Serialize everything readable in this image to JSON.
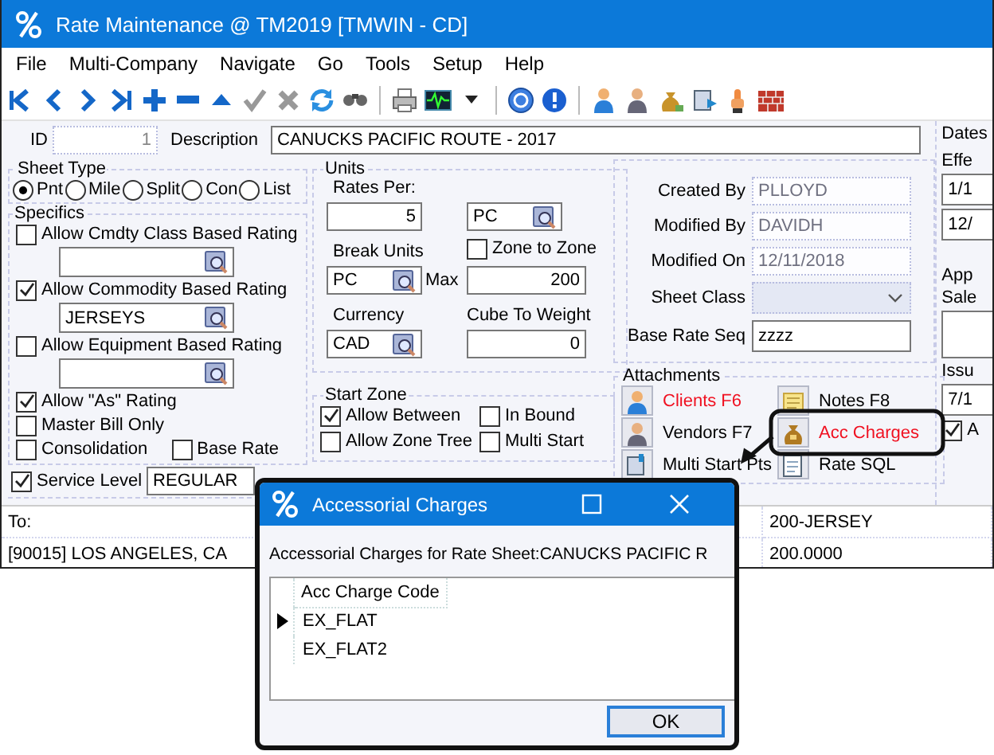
{
  "window": {
    "title": "Rate Maintenance @ TM2019 [TMWIN - CD]"
  },
  "menu": [
    "File",
    "Multi-Company",
    "Navigate",
    "Go",
    "Tools",
    "Setup",
    "Help"
  ],
  "header": {
    "id_label": "ID",
    "id": "1",
    "description_label": "Description",
    "description": "CANUCKS PACIFIC ROUTE - 2017"
  },
  "sheet_type": {
    "title": "Sheet Type",
    "options": [
      {
        "label": "Pnt",
        "selected": true
      },
      {
        "label": "Mile",
        "selected": false
      },
      {
        "label": "Split",
        "selected": false
      },
      {
        "label": "Con",
        "selected": false
      },
      {
        "label": "List",
        "selected": false
      }
    ]
  },
  "specifics": {
    "title": "Specifics",
    "items": [
      {
        "kind": "lookup",
        "label": "Allow Cmdty Class Based Rating",
        "checked": false
      },
      {
        "kind": "lookup",
        "label": "Allow Commodity Based Rating",
        "checked": true,
        "value": "JERSEYS"
      },
      {
        "kind": "lookup",
        "label": "Allow Equipment Based Rating",
        "checked": false
      },
      {
        "kind": "check",
        "label": "Allow \"As\" Rating",
        "checked": true
      },
      {
        "kind": "check",
        "label": "Master Bill Only",
        "checked": false
      },
      {
        "kind": "pair",
        "checks": [
          {
            "label": "Consolidation",
            "checked": false
          },
          {
            "label": "Base Rate",
            "checked": false
          }
        ]
      }
    ]
  },
  "service_level": {
    "label": "Service Level",
    "checked": true,
    "value": "REGULAR"
  },
  "units": {
    "title": "Units",
    "rates_per_label": "Rates Per:",
    "rates_per": "5",
    "rates_unit": "PC",
    "break_units_label": "Break Units",
    "break_units": "PC",
    "zone_to_zone": {
      "label": "Zone to Zone",
      "checked": false
    },
    "max_label": "Max",
    "max": "200",
    "currency_label": "Currency",
    "currency": "CAD",
    "cube_label": "Cube To Weight",
    "cube": "0"
  },
  "start_zone": {
    "title": "Start Zone",
    "checks": [
      {
        "label": "Allow Between",
        "checked": true
      },
      {
        "label": "In Bound",
        "checked": false
      },
      {
        "label": "Allow Zone Tree",
        "checked": false
      },
      {
        "label": "Multi Start",
        "checked": false
      }
    ]
  },
  "info": {
    "fields": [
      {
        "kind": "readonly",
        "label": "Created By",
        "value": "PLLOYD"
      },
      {
        "kind": "readonly",
        "label": "Modified By",
        "value": "DAVIDH"
      },
      {
        "kind": "readonly",
        "label": "Modified On",
        "value": "12/11/2018"
      },
      {
        "kind": "dropdown",
        "label": "Sheet Class"
      },
      {
        "kind": "text",
        "label": "Base Rate Seq",
        "value": "zzzz"
      }
    ]
  },
  "attachments": {
    "title": "Attachments",
    "items": [
      {
        "label": "Clients F6",
        "highlighted": true
      },
      {
        "label": "Notes F8",
        "highlighted": false
      },
      {
        "label": "Vendors F7",
        "highlighted": false
      },
      {
        "label": "Acc Charges",
        "highlighted": true
      },
      {
        "label": "Multi Start Pts",
        "highlighted": false
      },
      {
        "label": "Rate SQL",
        "highlighted": false
      }
    ]
  },
  "dates": {
    "title": "Dates",
    "effective_label": "Effe",
    "effective": [
      "1/1",
      "12/"
    ],
    "approved_label": "App",
    "sales_label": "Sale",
    "issued_label": "Issu",
    "issued": "7/1",
    "check": {
      "label": "A",
      "checked": true
    }
  },
  "route_grid": {
    "rows": [
      [
        "To:",
        "200-JERSEY"
      ],
      [
        "[90015] LOS ANGELES, CA",
        "200.0000"
      ]
    ]
  },
  "dialog": {
    "title": "Accessorial Charges",
    "caption": "Accessorial Charges for Rate Sheet:CANUCKS PACIFIC R",
    "columns": [
      "Acc Charge Code"
    ],
    "rows": [
      {
        "code": "EX_FLAT",
        "selected": true
      },
      {
        "code": "EX_FLAT2",
        "selected": false
      }
    ],
    "ok": "OK"
  }
}
